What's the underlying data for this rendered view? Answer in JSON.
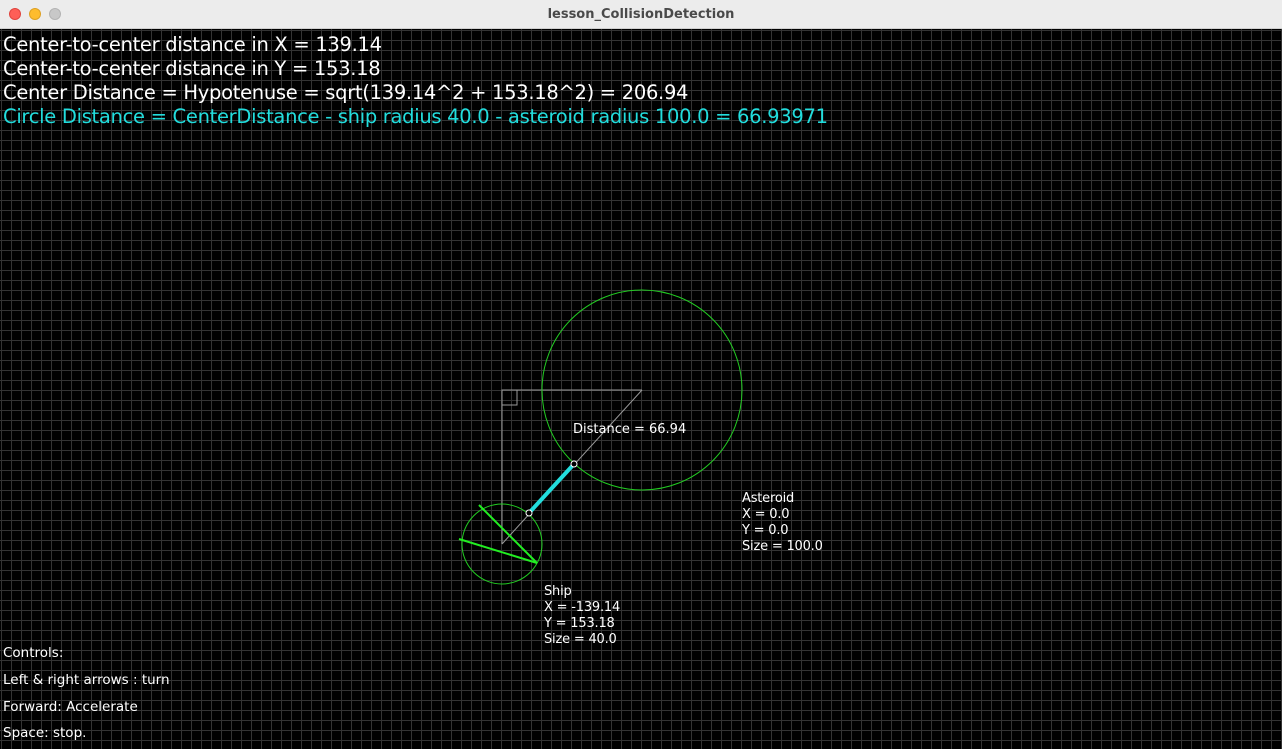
{
  "window": {
    "title": "lesson_CollisionDetection"
  },
  "info": {
    "line_x": "Center-to-center distance in X = 139.14",
    "line_y": "Center-to-center distance in Y = 153.18",
    "line_hyp": "Center Distance = Hypotenuse = sqrt(139.14^2 + 153.18^2) = 206.94",
    "line_circle": "Circle Distance = CenterDistance - ship radius 40.0 - asteroid radius 100.0 = 66.93971"
  },
  "scene": {
    "distance_label": "Distance = 66.94"
  },
  "asteroid": {
    "title": "Asteroid",
    "x": "X = 0.0",
    "y": "Y = 0.0",
    "size": "Size = 100.0"
  },
  "ship": {
    "title": "Ship",
    "x": "X = -139.14",
    "y": "Y = 153.18",
    "size": "Size = 40.0"
  },
  "controls": {
    "heading": "Controls:",
    "turn": "Left & right arrows : turn",
    "forward": "Forward: Accelerate",
    "space": "Space: stop."
  },
  "colors": {
    "background": "#000000",
    "grid": "#333333",
    "accent": "#22dddd",
    "circle": "#22cc22",
    "ship_line": "#22ee22",
    "text": "#ffffff"
  }
}
